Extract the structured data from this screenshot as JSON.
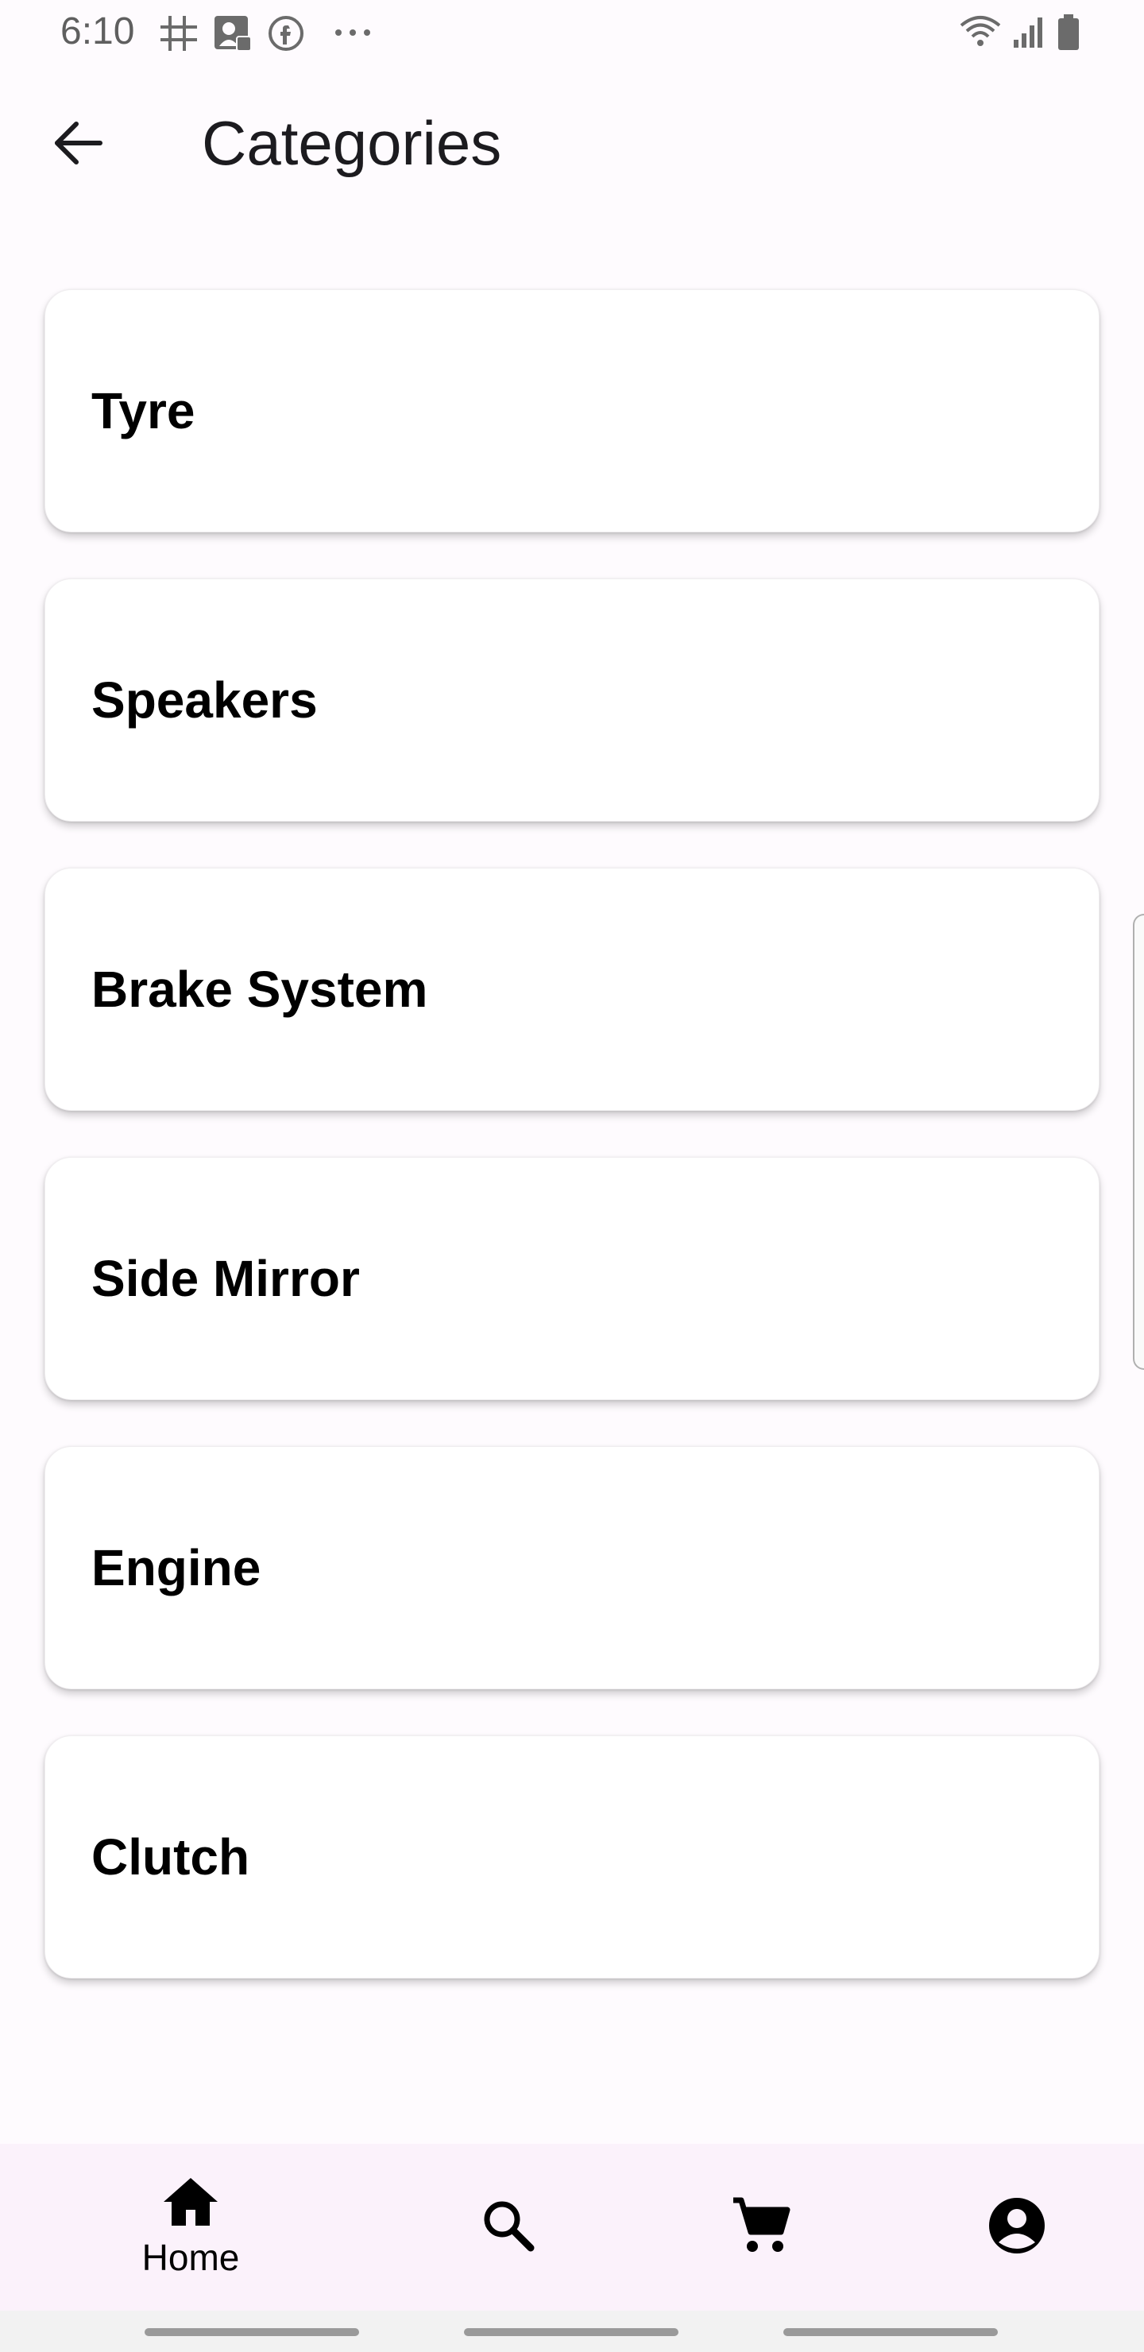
{
  "status_bar": {
    "time": "6:10",
    "icons": [
      "grid-app-icon",
      "contact-card-icon",
      "facebook-icon",
      "more-dots-icon",
      "wifi-icon",
      "signal-icon",
      "battery-icon"
    ]
  },
  "app_bar": {
    "back_icon": "arrow-back-icon",
    "title": "Categories"
  },
  "categories": [
    {
      "label": "Tyre"
    },
    {
      "label": "Speakers"
    },
    {
      "label": "Brake System"
    },
    {
      "label": "Side Mirror"
    },
    {
      "label": "Engine"
    },
    {
      "label": "Clutch"
    }
  ],
  "bottom_nav": {
    "items": [
      {
        "icon": "home-icon",
        "label": "Home",
        "selected": true
      },
      {
        "icon": "search-icon",
        "label": ""
      },
      {
        "icon": "cart-icon",
        "label": ""
      },
      {
        "icon": "account-icon",
        "label": ""
      }
    ]
  },
  "colors": {
    "background": "#fefbfe",
    "card": "#ffffff",
    "nav_background": "#fbf2fb",
    "text": "#000000"
  }
}
